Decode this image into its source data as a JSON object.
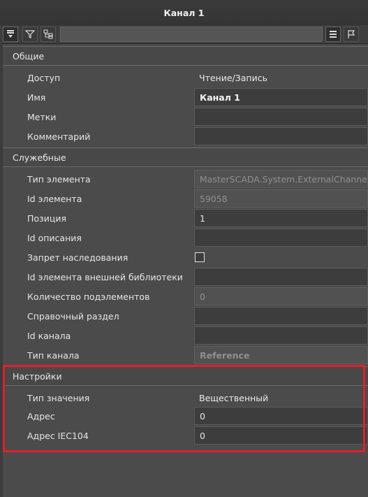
{
  "window": {
    "title": "Канал 1"
  },
  "toolbar": {
    "left_icons": [
      "sort-icon",
      "filter-icon",
      "hierarchy-icon"
    ],
    "search": {
      "value": "",
      "placeholder": ""
    },
    "right_icons": [
      "list-view-icon",
      "flag-icon"
    ]
  },
  "groups": [
    {
      "title": "Общие",
      "rows": [
        {
          "name": "Доступ",
          "value": "Чтение/Запись",
          "kind": "plain"
        },
        {
          "name": "Имя",
          "value": "Канал 1",
          "kind": "bold"
        },
        {
          "name": "Метки",
          "value": "",
          "kind": "editable"
        },
        {
          "name": "Комментарий",
          "value": "",
          "kind": "editable"
        }
      ]
    },
    {
      "title": "Служебные",
      "rows": [
        {
          "name": "Тип элемента",
          "value": "MasterSCADA.System.ExternalChannel",
          "kind": "disabled"
        },
        {
          "name": "Id элемента",
          "value": "59058",
          "kind": "disabled"
        },
        {
          "name": "Позиция",
          "value": "1",
          "kind": "editable"
        },
        {
          "name": "Id описания",
          "value": "",
          "kind": "editable"
        },
        {
          "name": "Запрет наследования",
          "value": "",
          "kind": "checkbox"
        },
        {
          "name": "Id элемента внешней библиотеки",
          "value": "",
          "kind": "editable"
        },
        {
          "name": "Количество подэлементов",
          "value": "0",
          "kind": "disabled"
        },
        {
          "name": "Справочный раздел",
          "value": "",
          "kind": "editable"
        },
        {
          "name": "Id канала",
          "value": "",
          "kind": "editable"
        },
        {
          "name": "Тип канала",
          "value": "Reference",
          "kind": "dim-bold"
        }
      ]
    },
    {
      "title": "Настройки",
      "rows": [
        {
          "name": "Тип значения",
          "value": "Вещественный",
          "kind": "plain"
        },
        {
          "name": "Адрес",
          "value": "0",
          "kind": "editable"
        },
        {
          "name": "Адрес IEC104",
          "value": "0",
          "kind": "editable"
        }
      ]
    }
  ],
  "colors": {
    "highlight": "#e0202a",
    "background": "#4a4a4a"
  }
}
